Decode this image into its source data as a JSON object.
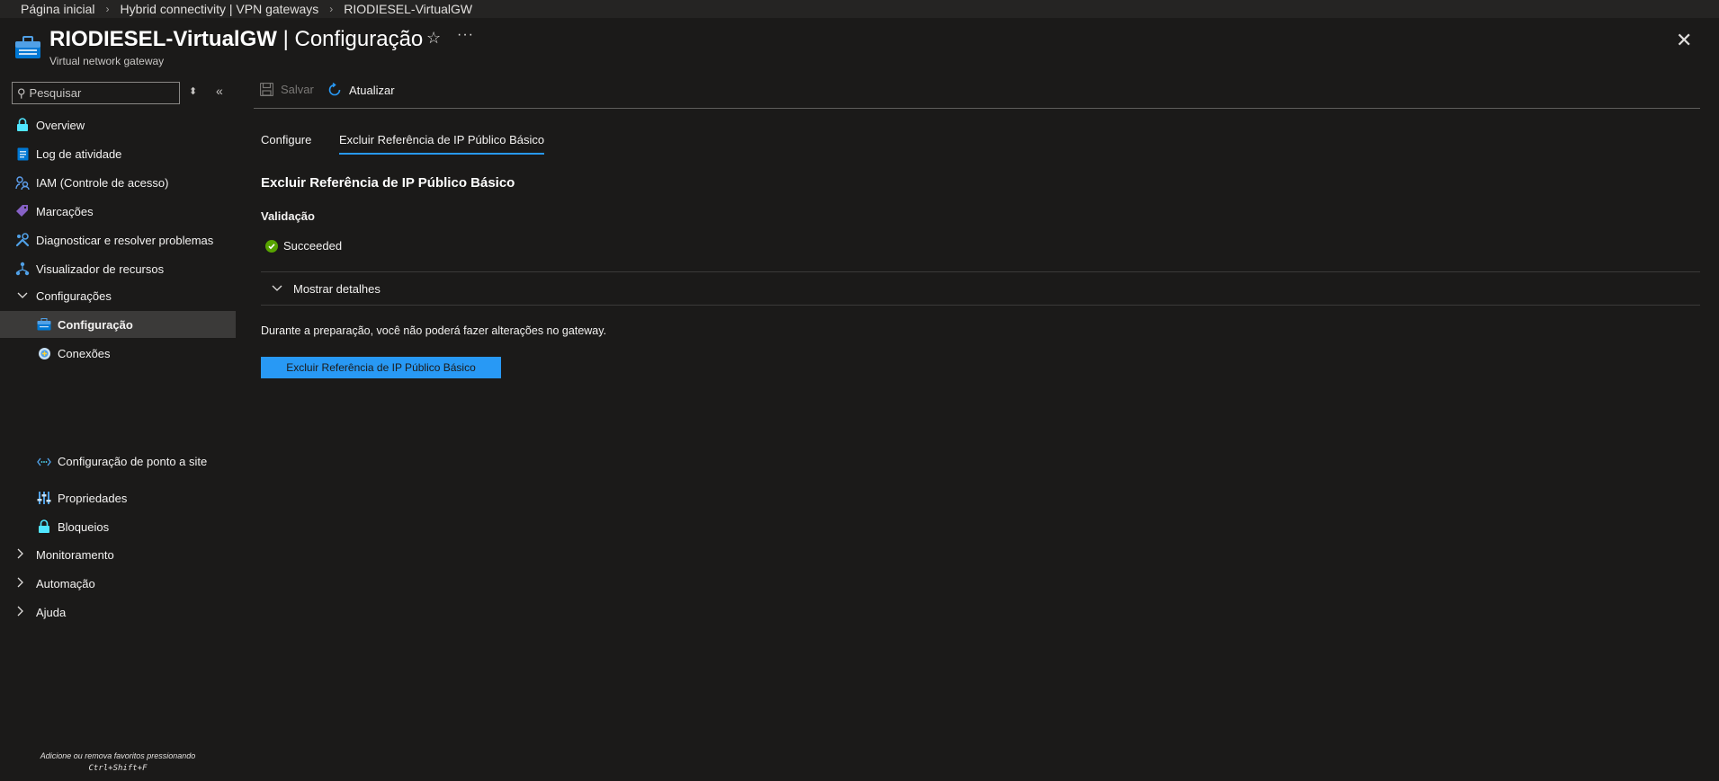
{
  "breadcrumb": {
    "items": [
      "Página inicial",
      "Hybrid connectivity | VPN gateways",
      "RIODIESEL-VirtualGW"
    ]
  },
  "header": {
    "resource_name": "RIODIESEL-VirtualGW",
    "separator": " | ",
    "page_name": "Configuração",
    "subtitle": "Virtual network gateway",
    "star_icon": "star-icon",
    "more_icon": "ellipsis-icon",
    "close_icon": "close-icon"
  },
  "sidebar": {
    "search_placeholder": "Pesquisar",
    "items": [
      {
        "label": "Overview",
        "icon": "lock-overview-icon"
      },
      {
        "label": "Log de atividade",
        "icon": "activity-log-icon"
      },
      {
        "label": "IAM (Controle de acesso)",
        "icon": "iam-icon"
      },
      {
        "label": "Marcações",
        "icon": "tag-icon"
      },
      {
        "label": "Diagnosticar e resolver problemas",
        "icon": "wrench-icon"
      },
      {
        "label": "Visualizador de recursos",
        "icon": "resource-visualizer-icon"
      },
      {
        "label": "Configurações",
        "icon": "chevron-down-icon"
      },
      {
        "label": "Configuração",
        "icon": "gateway-icon",
        "selected": true
      },
      {
        "label": "Conexões",
        "icon": "connections-icon"
      },
      {
        "label": "Configuração de ponto a site",
        "icon": "point-to-site-icon"
      },
      {
        "label": "Propriedades",
        "icon": "properties-icon"
      },
      {
        "label": "Bloqueios",
        "icon": "lock-icon"
      },
      {
        "label": "Monitoramento",
        "icon": "chevron-right-icon"
      },
      {
        "label": "Automação",
        "icon": "chevron-right-icon"
      },
      {
        "label": "Ajuda",
        "icon": "chevron-right-icon"
      }
    ],
    "favorites_hint": "Adicione ou remova favoritos pressionando",
    "favorites_keys": "Ctrl+Shift+F"
  },
  "toolbar": {
    "save_label": "Salvar",
    "refresh_label": "Atualizar"
  },
  "tabs": [
    {
      "label": "Configure"
    },
    {
      "label": "Excluir Referência de IP Público Básico",
      "active": true
    }
  ],
  "main": {
    "section_title": "Excluir Referência de IP Público Básico",
    "validation_label": "Validação",
    "status_text": "Succeeded",
    "details_label": "Mostrar detalhes",
    "info_text": "Durante a preparação, você não poderá fazer alterações no gateway.",
    "primary_button": "Excluir Referência de IP Público Básico"
  },
  "colors": {
    "accent": "#2899f5",
    "success": "#57a300",
    "background": "#1b1a19",
    "selected_bg": "#3b3a39"
  }
}
